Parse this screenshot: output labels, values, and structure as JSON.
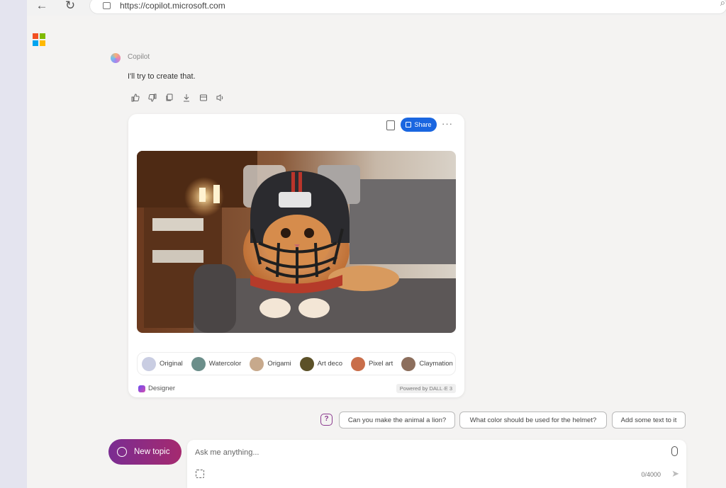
{
  "browser": {
    "url": "https://copilot.microsoft.com",
    "icons": {
      "back": "back-arrow-icon",
      "reload": "reload-icon",
      "lock": "lock-icon",
      "zoom": "zoom-icon"
    }
  },
  "logo": {
    "colors": [
      "#f25022",
      "#7fba00",
      "#00a4ef",
      "#ffb900"
    ]
  },
  "response": {
    "author": "Copilot",
    "text": "I'll try to create that.",
    "actions": [
      "thumbs-up-icon",
      "thumbs-down-icon",
      "copy-icon",
      "download-icon",
      "export-icon",
      "read-aloud-icon"
    ]
  },
  "image_card": {
    "share_label": "Share",
    "styles": [
      {
        "label": "Original",
        "color": "#c9cde2"
      },
      {
        "label": "Watercolor",
        "color": "#6b8e8a"
      },
      {
        "label": "Origami",
        "color": "#c7a98c"
      },
      {
        "label": "Art deco",
        "color": "#5c5128"
      },
      {
        "label": "Pixel art",
        "color": "#c96e4a"
      },
      {
        "label": "Claymation",
        "color": "#8c6e5c"
      }
    ],
    "designer_label": "Designer",
    "powered_by": "Powered by DALL·E 3"
  },
  "suggestions": [
    "Can you make the animal a lion?",
    "What color should be used for the helmet?",
    "Add some text to it"
  ],
  "composer": {
    "new_topic_label": "New topic",
    "placeholder": "Ask me anything...",
    "char_count": "0/4000"
  },
  "colors": {
    "accent": "#1a66e0",
    "brand": "#8b2d86"
  }
}
